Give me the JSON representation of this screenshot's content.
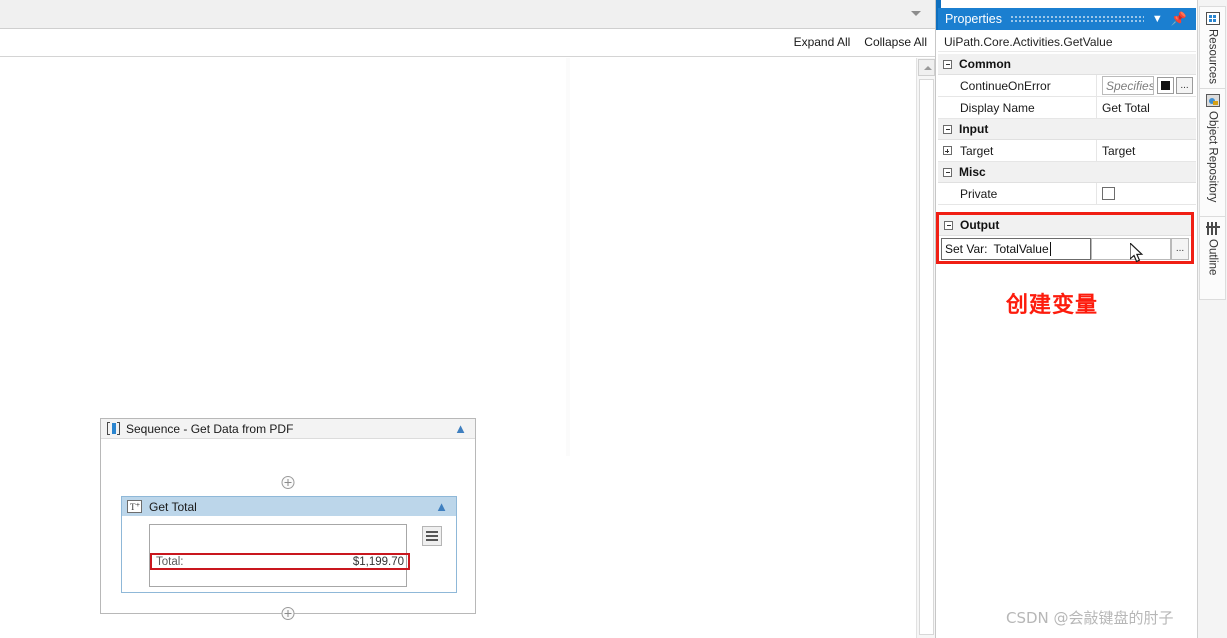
{
  "top_toolbar": {
    "dropdown_icon": "chevron-down-icon"
  },
  "subbar": {
    "expand_all": "Expand All",
    "collapse_all": "Collapse All"
  },
  "designer": {
    "sequence": {
      "title": "Sequence - Get Data from PDF",
      "icon": "sequence-icon",
      "collapse_icon": "chevron-up-icon",
      "add_above": "+",
      "add_below": "+",
      "activity": {
        "title": "Get Total",
        "icon": "get-text-icon",
        "collapse_icon": "chevron-up-icon",
        "target_label": "Total:",
        "target_value": "$1,199.70",
        "menu_icon": "hamburger-icon"
      }
    },
    "scrollbar": {
      "up_arrow": "scroll-up-icon"
    }
  },
  "properties": {
    "title": "Properties",
    "dropdown_icon": "chevron-down-icon",
    "pin_icon": "pin-icon",
    "type_name": "UiPath.Core.Activities.GetValue",
    "groups": [
      {
        "name": "Common",
        "rows": [
          {
            "name": "ContinueOnError",
            "value": "",
            "placeholder": "Specifies",
            "has_square_button": true,
            "has_ellipsis_button": true,
            "ellipsis_label": "..."
          },
          {
            "name": "Display Name",
            "value": "Get Total"
          }
        ]
      },
      {
        "name": "Input",
        "rows": [
          {
            "name": "Target",
            "value": "Target",
            "expandable": true
          }
        ]
      },
      {
        "name": "Misc",
        "rows": [
          {
            "name": "Private",
            "value": "",
            "checkbox": true,
            "checked": false
          }
        ]
      }
    ],
    "output": {
      "group_name": "Output",
      "field_label": "Set Var:",
      "field_value": "TotalValue",
      "ellipsis_label": "...",
      "highlight_color": "#f01f14"
    }
  },
  "annotation": {
    "text": "创建变量",
    "color": "#fd1c0d"
  },
  "watermark": {
    "text": "CSDN @会敲键盘的肘子"
  },
  "rail": {
    "items": [
      {
        "label": "Resources",
        "icon": "resources-icon"
      },
      {
        "label": "Object Repository",
        "icon": "object-repository-icon"
      },
      {
        "label": "Outline",
        "icon": "outline-icon"
      }
    ]
  }
}
